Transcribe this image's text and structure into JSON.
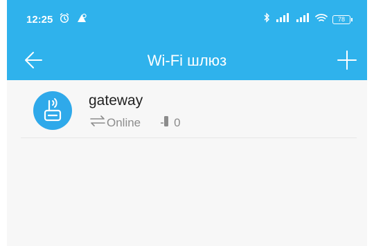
{
  "status_bar": {
    "time": "12:25",
    "battery": "78"
  },
  "header": {
    "title": "Wi-Fi шлюз"
  },
  "devices": [
    {
      "name": "gateway",
      "status": "Online",
      "count": "0"
    }
  ],
  "colors": {
    "primary": "#2fb2ec",
    "background": "#f7f7f7",
    "title_text": "#ffffff",
    "name_text": "#222222",
    "meta_text": "#8c8c8c"
  },
  "icons": {
    "back": "arrow-left-icon",
    "add": "plus-icon",
    "device": "router-icon",
    "status": "swap-arrows-icon",
    "count": "device-count-icon",
    "alarm": "alarm-clock-icon",
    "app": "notification-app-icon",
    "bluetooth": "bluetooth-icon",
    "signal": "signal-icon",
    "wifi": "wifi-icon",
    "battery": "battery-icon"
  }
}
